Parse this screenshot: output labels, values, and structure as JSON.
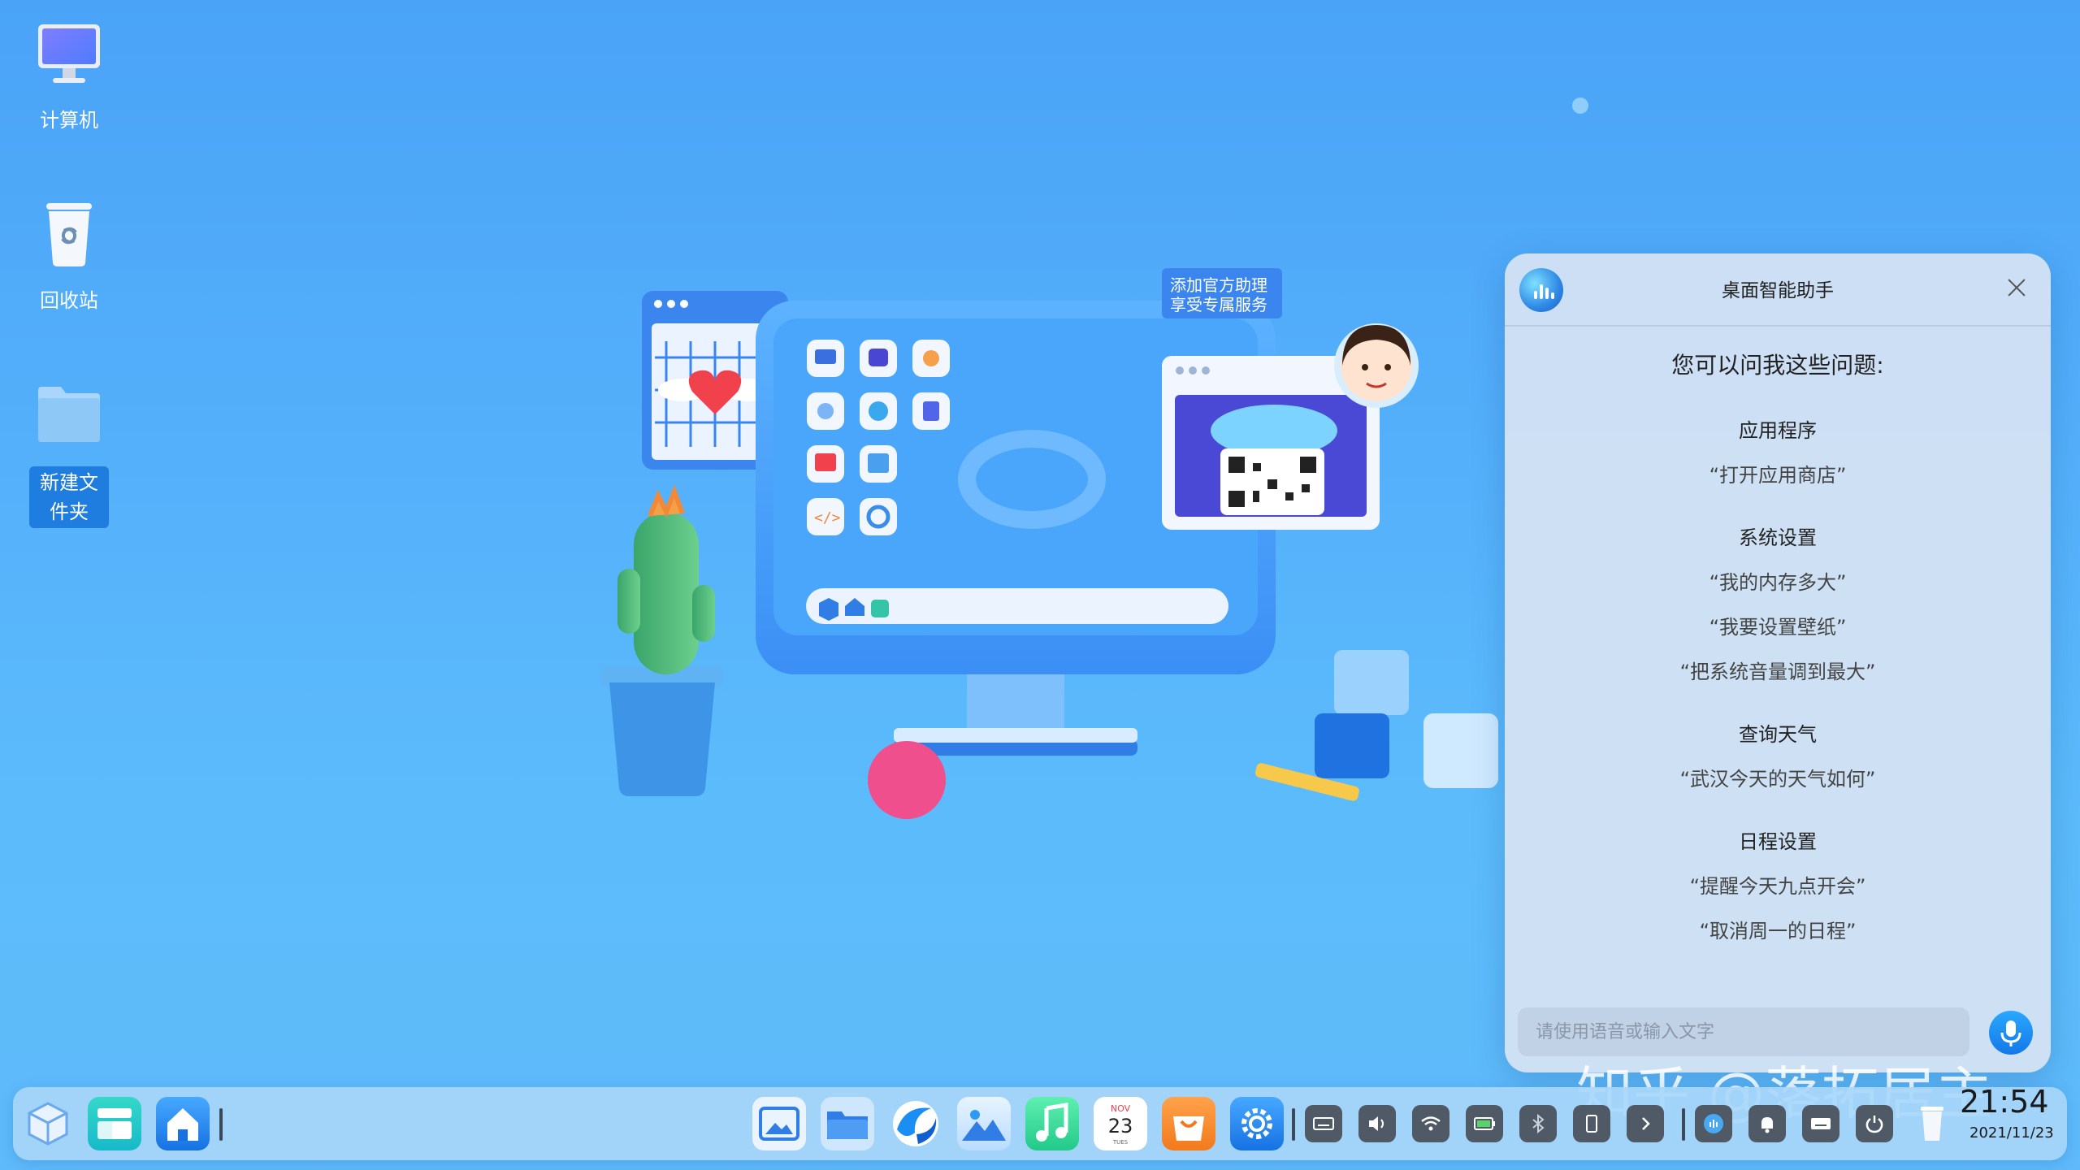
{
  "desktop": {
    "icons": [
      {
        "label": "计算机"
      },
      {
        "label": "回收站"
      },
      {
        "label": "新建文件夹",
        "label_line1": "新建文",
        "label_line2": "件夹"
      }
    ]
  },
  "illustration": {
    "banner_line1": "添加官方助理",
    "banner_line2": "享受专属服务"
  },
  "assistant": {
    "title": "桌面智能助手",
    "question": "您可以问我这些问题:",
    "categories": [
      {
        "name": "应用程序",
        "examples": [
          "“打开应用商店”"
        ]
      },
      {
        "name": "系统设置",
        "examples": [
          "“我的内存多大”",
          "“我要设置壁纸”",
          "“把系统音量调到最大”"
        ]
      },
      {
        "name": "查询天气",
        "examples": [
          "“武汉今天的天气如何”"
        ]
      },
      {
        "name": "日程设置",
        "examples": [
          "“提醒今天九点开会”",
          "“取消周一的日程”"
        ]
      }
    ],
    "input_placeholder": "请使用语音或输入文字"
  },
  "watermark": "知乎 @落拓居主",
  "taskbar": {
    "calendar_month": "NOV",
    "calendar_day": "23",
    "calendar_weekday": "TUES",
    "time": "21:54",
    "date": "2021/11/23"
  },
  "colors": {
    "desktop_bg": "#56b2fb",
    "panel_bg": "#d6e3f3",
    "accent": "#1f7de0"
  }
}
